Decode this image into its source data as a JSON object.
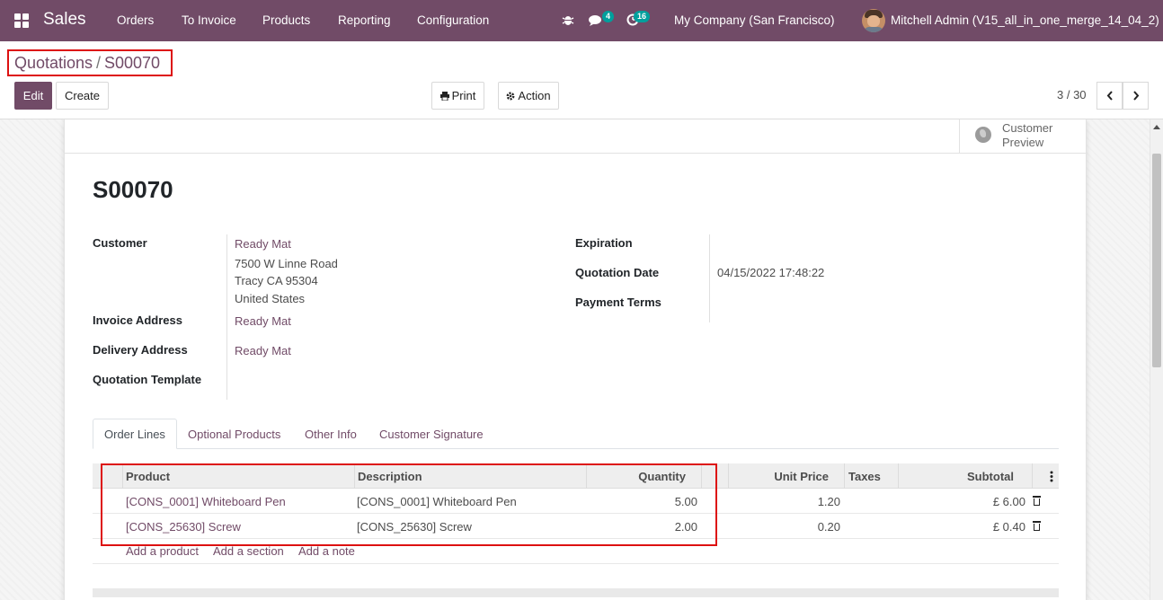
{
  "navbar": {
    "brand": "Sales",
    "menu": [
      "Orders",
      "To Invoice",
      "Products",
      "Reporting",
      "Configuration"
    ],
    "messages_count": "4",
    "activities_count": "16",
    "company": "My Company (San Francisco)",
    "user": "Mitchell Admin (V15_all_in_one_merge_14_04_2)",
    "color": "#714b67"
  },
  "breadcrumb": {
    "parent": "Quotations",
    "separator": "/",
    "current": "S00070"
  },
  "toolbar": {
    "edit": "Edit",
    "create": "Create",
    "print": "Print",
    "action": "Action",
    "pager": "3 / 30"
  },
  "stat_button": {
    "line1": "Customer",
    "line2": "Preview"
  },
  "form": {
    "title": "S00070",
    "customer_label": "Customer",
    "customer_name": "Ready Mat",
    "customer_address_1": "7500 W Linne Road",
    "customer_address_2": "Tracy CA 95304",
    "customer_address_3": "United States",
    "invoice_address_label": "Invoice Address",
    "invoice_address": "Ready Mat",
    "delivery_address_label": "Delivery Address",
    "delivery_address": "Ready Mat",
    "quotation_template_label": "Quotation Template",
    "expiration_label": "Expiration",
    "quotation_date_label": "Quotation Date",
    "quotation_date": "04/15/2022 17:48:22",
    "payment_terms_label": "Payment Terms"
  },
  "tabs": [
    "Order Lines",
    "Optional Products",
    "Other Info",
    "Customer Signature"
  ],
  "table": {
    "headers": {
      "product": "Product",
      "description": "Description",
      "quantity": "Quantity",
      "unit_price": "Unit Price",
      "taxes": "Taxes",
      "subtotal": "Subtotal"
    },
    "rows": [
      {
        "product": "[CONS_0001] Whiteboard Pen",
        "description": "[CONS_0001] Whiteboard Pen",
        "quantity": "5.00",
        "unit_price": "1.20",
        "taxes": "",
        "subtotal": "£ 6.00"
      },
      {
        "product": "[CONS_25630] Screw",
        "description": "[CONS_25630] Screw",
        "quantity": "2.00",
        "unit_price": "0.20",
        "taxes": "",
        "subtotal": "£ 0.40"
      }
    ],
    "add_product": "Add a product",
    "add_section": "Add a section",
    "add_note": "Add a note"
  }
}
